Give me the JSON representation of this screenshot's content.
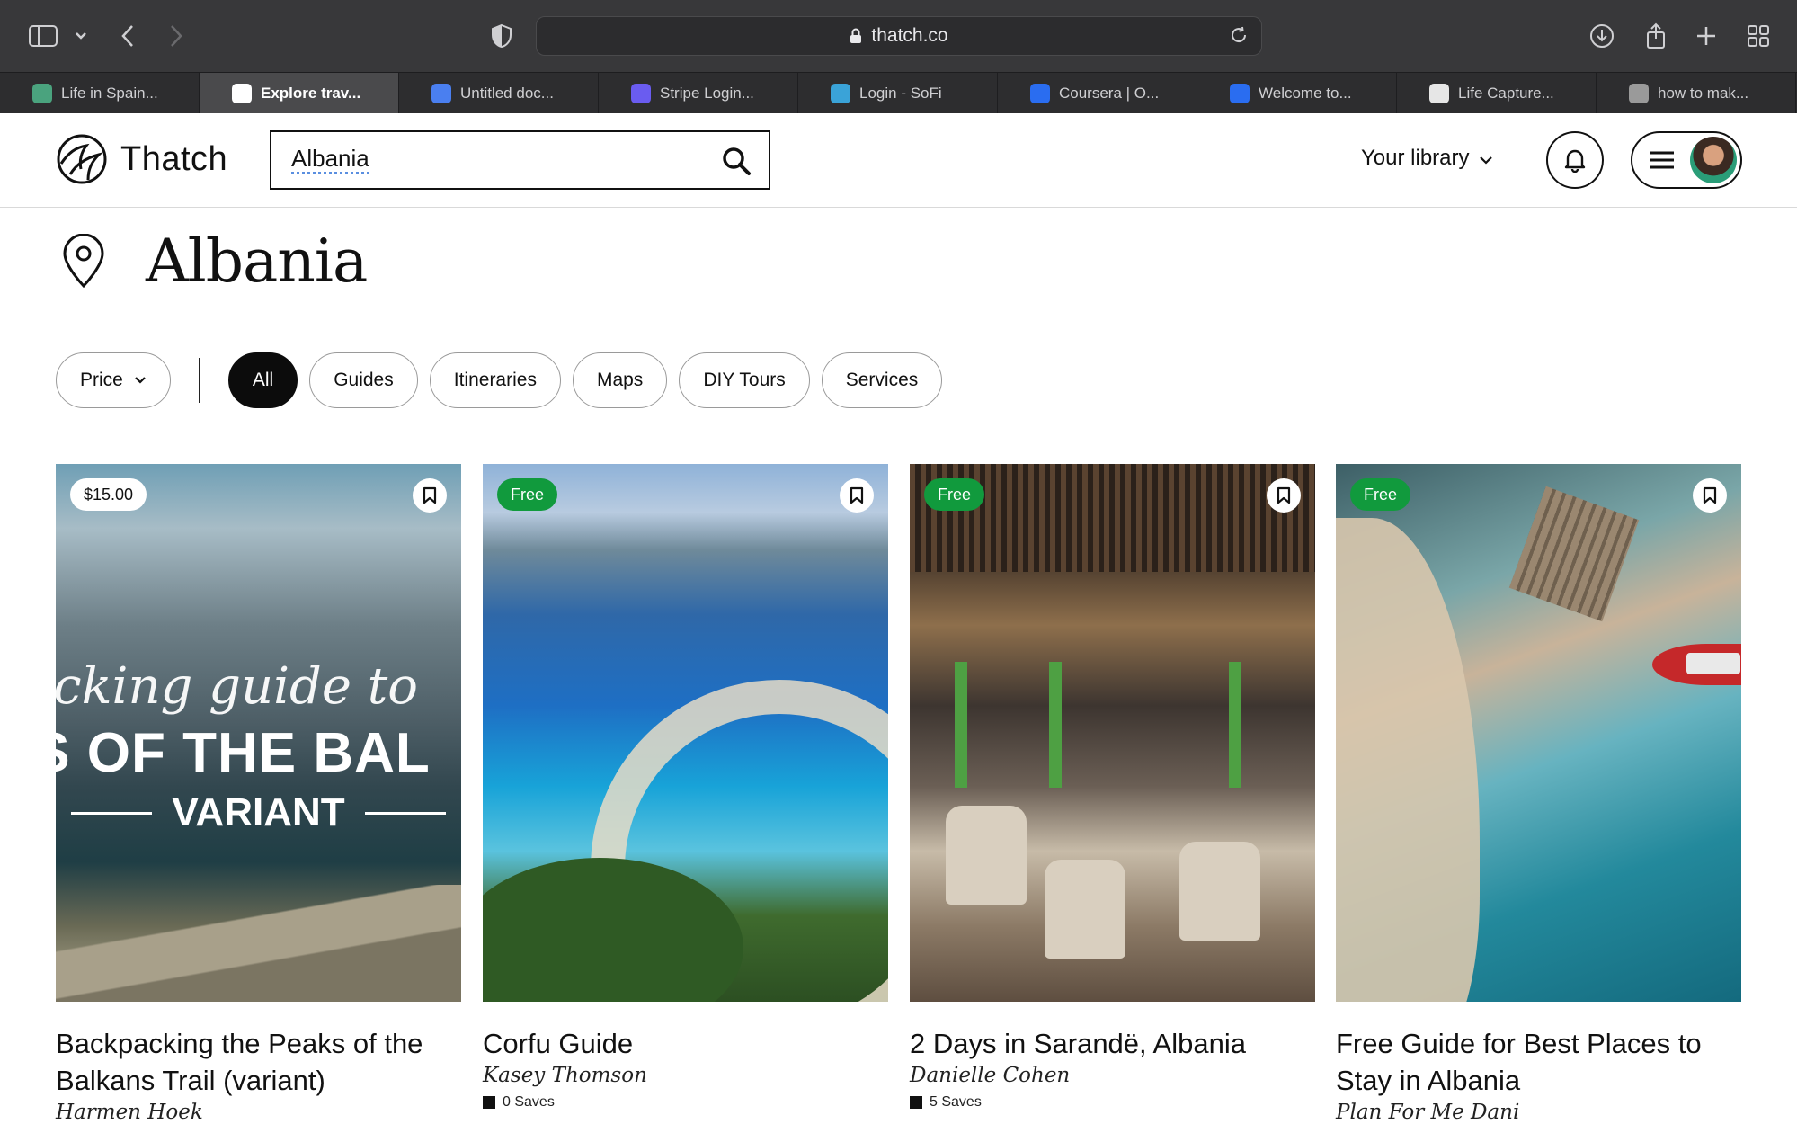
{
  "browser": {
    "url": "thatch.co",
    "tabs": [
      {
        "label": "Life in Spain...",
        "icon": "chatgpt-icon",
        "color": "#4aa37e",
        "active": false
      },
      {
        "label": "Explore trav...",
        "icon": "thatch-icon",
        "color": "#ffffff",
        "active": true
      },
      {
        "label": "Untitled doc...",
        "icon": "google-docs-icon",
        "color": "#4a7ff0",
        "active": false
      },
      {
        "label": "Stripe Login...",
        "icon": "stripe-icon",
        "color": "#6a5cf0",
        "active": false
      },
      {
        "label": "Login - SoFi",
        "icon": "sofi-icon",
        "color": "#3aa3d8",
        "active": false
      },
      {
        "label": "Coursera | O...",
        "icon": "coursera-icon",
        "color": "#2a6df0",
        "active": false
      },
      {
        "label": "Welcome to...",
        "icon": "coursera-icon",
        "color": "#2a6df0",
        "active": false
      },
      {
        "label": "Life Capture...",
        "icon": "life-capture-icon",
        "color": "#e6e6e6",
        "active": false
      },
      {
        "label": "how to mak...",
        "icon": "google-icon",
        "color": "#9a9a9a",
        "active": false
      }
    ]
  },
  "header": {
    "logo_text": "Thatch",
    "search_value": "Albania",
    "library_label": "Your library"
  },
  "page": {
    "title": "Albania"
  },
  "filters": {
    "price_label": "Price",
    "chips": [
      "All",
      "Guides",
      "Itineraries",
      "Maps",
      "DIY Tours",
      "Services"
    ],
    "active": "All"
  },
  "cards": [
    {
      "badge": "$15.00",
      "badge_type": "price",
      "title": "Backpacking the Peaks of the Balkans Trail (variant)",
      "author": "Harmen Hoek",
      "image_text": {
        "script": "packing guide to",
        "big": "S OF THE BAL",
        "variant": "VARIANT"
      }
    },
    {
      "badge": "Free",
      "badge_type": "free",
      "title": "Corfu Guide",
      "author": "Kasey Thomson",
      "saves": "0 Saves"
    },
    {
      "badge": "Free",
      "badge_type": "free",
      "title": "2 Days in Sarandë, Albania",
      "author": "Danielle Cohen",
      "saves": "5 Saves"
    },
    {
      "badge": "Free",
      "badge_type": "free",
      "title": "Free Guide for Best Places to Stay in Albania",
      "author": "Plan For Me Dani"
    }
  ]
}
